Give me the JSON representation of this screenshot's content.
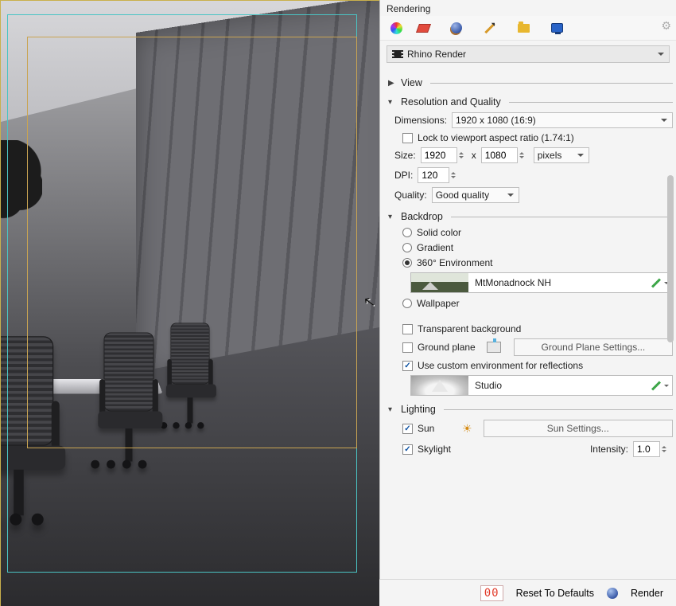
{
  "panel_title": "Rendering",
  "renderer": {
    "current": "Rhino Render"
  },
  "toolbar_icons": [
    "colorwheel",
    "redlayer",
    "sphere",
    "pencil",
    "folder",
    "monitor"
  ],
  "sections": {
    "view": {
      "label": "View",
      "expanded": false
    },
    "resq": {
      "label": "Resolution and Quality",
      "dimensions_label": "Dimensions:",
      "dimensions_value": "1920 x 1080 (16:9)",
      "lock_label": "Lock to viewport aspect ratio (1.74:1)",
      "size_label": "Size:",
      "size_w": "1920",
      "size_x": "x",
      "size_h": "1080",
      "size_units": "pixels",
      "dpi_label": "DPI:",
      "dpi_value": "120",
      "quality_label": "Quality:",
      "quality_value": "Good quality"
    },
    "backdrop": {
      "label": "Backdrop",
      "opt_solid": "Solid color",
      "opt_gradient": "Gradient",
      "opt_env": "360° Environment",
      "env_name": "MtMonadnock NH",
      "opt_wallpaper": "Wallpaper",
      "transparent_label": "Transparent background",
      "ground_label": "Ground plane",
      "ground_settings": "Ground Plane Settings...",
      "custom_refl_label": "Use custom environment for reflections",
      "refl_env_name": "Studio"
    },
    "lighting": {
      "label": "Lighting",
      "sun_label": "Sun",
      "sun_settings": "Sun Settings...",
      "skylight_label": "Skylight",
      "intensity_label": "Intensity:",
      "intensity_value": "1.0"
    }
  },
  "footer": {
    "counter": "00",
    "reset": "Reset To Defaults",
    "render": "Render"
  }
}
